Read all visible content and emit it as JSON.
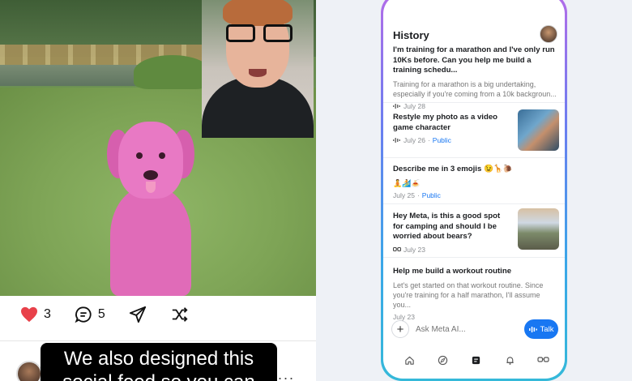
{
  "post": {
    "likes": "3",
    "comments": "5",
    "caption": "We also designed this social feed so you can discover",
    "more": "..."
  },
  "history": {
    "title": "History",
    "items": [
      {
        "title": "I'm training for a marathon and I've only run 10Ks before. Can you help me build a training schedu...",
        "preview": "Training for a marathon is a big undertaking, especially if you're coming from a 10k backgroun...",
        "date": "July 28",
        "visibility": "",
        "icon": "voice-wave-icon"
      },
      {
        "title": "Restyle my photo as a video game character",
        "preview": "",
        "date": "July 26",
        "visibility": "Public",
        "icon": "voice-wave-icon"
      },
      {
        "title": "Describe me in 3 emojis 😉🦒🐌",
        "preview": "🧘🏄🍝",
        "date": "July 25",
        "visibility": "Public",
        "icon": ""
      },
      {
        "title": "Hey Meta, is this a good spot for camping and should I be worried about bears?",
        "preview": "",
        "date": "July 23",
        "visibility": "",
        "icon": "glasses-icon"
      },
      {
        "title": "Help me build a workout routine",
        "preview": "Let's get started on that workout routine. Since you're training for a half marathon, I'll assume you...",
        "date": "July 23",
        "visibility": "",
        "icon": ""
      }
    ]
  },
  "composer": {
    "placeholder": "Ask Meta AI...",
    "talk_label": "Talk"
  },
  "colors": {
    "accent": "#1877f2",
    "like": "#e8414a",
    "pink_dog": "#e06bb8"
  }
}
